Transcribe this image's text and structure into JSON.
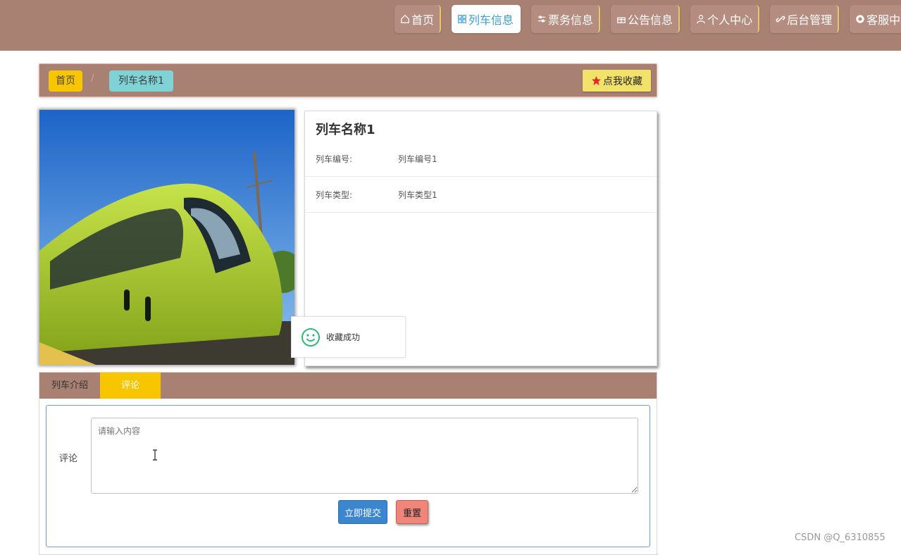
{
  "nav": {
    "items": [
      {
        "label": "首页",
        "icon": "home-icon",
        "active": false
      },
      {
        "label": "列车信息",
        "icon": "grid-icon",
        "active": true
      },
      {
        "label": "票务信息",
        "icon": "sliders-icon",
        "active": false
      },
      {
        "label": "公告信息",
        "icon": "gift-icon",
        "active": false
      },
      {
        "label": "个人中心",
        "icon": "user-icon",
        "active": false
      },
      {
        "label": "后台管理",
        "icon": "link-icon",
        "active": false
      },
      {
        "label": "客服中心",
        "icon": "chat-icon",
        "active": false
      }
    ]
  },
  "breadcrumb": {
    "home": "首页",
    "separator": "/",
    "current": "列车名称1"
  },
  "favorite_button": "点我收藏",
  "train": {
    "name": "列车名称1",
    "fields": [
      {
        "label": "列车编号:",
        "value": "列车编号1"
      },
      {
        "label": "列车类型:",
        "value": "列车类型1"
      }
    ]
  },
  "toast": {
    "message": "收藏成功"
  },
  "tabs": [
    {
      "label": "列车介绍",
      "active": false
    },
    {
      "label": "评论",
      "active": true
    }
  ],
  "comment_form": {
    "label": "评论",
    "placeholder": "请输入内容",
    "submit": "立即提交",
    "reset": "重置"
  },
  "watermark": "CSDN @Q_6310855",
  "colors": {
    "header": "#a98173",
    "accent_yellow": "#f7c600",
    "active_link": "#3aa0d8",
    "submit": "#3b86cf",
    "reset": "#f0857a"
  }
}
